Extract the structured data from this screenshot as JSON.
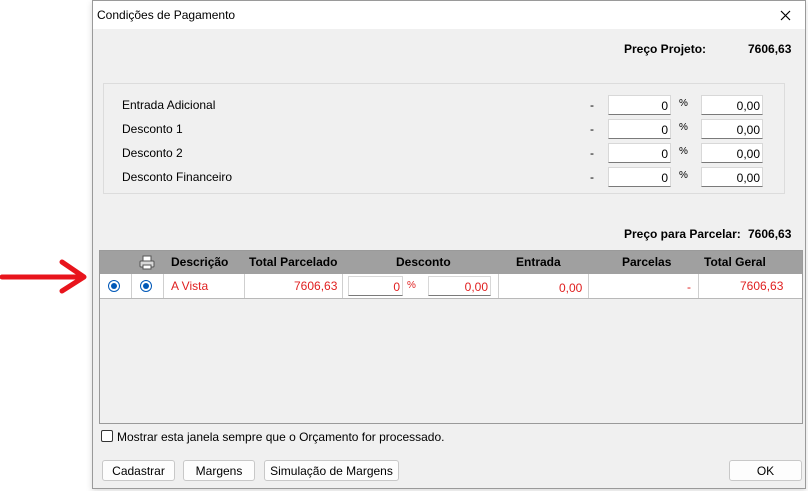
{
  "window": {
    "title": "Condições de Pagamento",
    "close_icon": "close-icon"
  },
  "preco_projeto": {
    "label": "Preço Projeto:",
    "value": "7606,63"
  },
  "descontos": [
    {
      "label": "Entrada Adicional",
      "dash": "-",
      "pct": "0",
      "pct_sign": "%",
      "value": "0,00"
    },
    {
      "label": "Desconto 1",
      "dash": "-",
      "pct": "0",
      "pct_sign": "%",
      "value": "0,00"
    },
    {
      "label": "Desconto 2",
      "dash": "-",
      "pct": "0",
      "pct_sign": "%",
      "value": "0,00"
    },
    {
      "label": "Desconto Financeiro",
      "dash": "-",
      "pct": "0",
      "pct_sign": "%",
      "value": "0,00"
    }
  ],
  "preco_parcelar": {
    "label": "Preço para Parcelar:",
    "value": "7606,63"
  },
  "grid": {
    "columns": [
      "Descrição",
      "Total Parcelado",
      "Desconto",
      "Entrada",
      "Parcelas",
      "Total Geral"
    ],
    "rows": [
      {
        "descricao": "A Vista",
        "total_parcelado": "7606,63",
        "desconto_pct": "0",
        "pct_sign": "%",
        "desconto_valor": "0,00",
        "entrada": "0,00",
        "parcelas": "-",
        "total_geral": "7606,63"
      }
    ]
  },
  "checkbox_label": "Mostrar esta janela sempre que o Orçamento for processado.",
  "buttons": {
    "cadastrar": "Cadastrar",
    "margens": "Margens",
    "simulacao": "Simulação de Margens",
    "ok": "OK"
  },
  "colors": {
    "arrow": "#e8141c",
    "row_text": "#e02020",
    "header_bg": "#a0a0a0",
    "radio": "#0058b8"
  }
}
